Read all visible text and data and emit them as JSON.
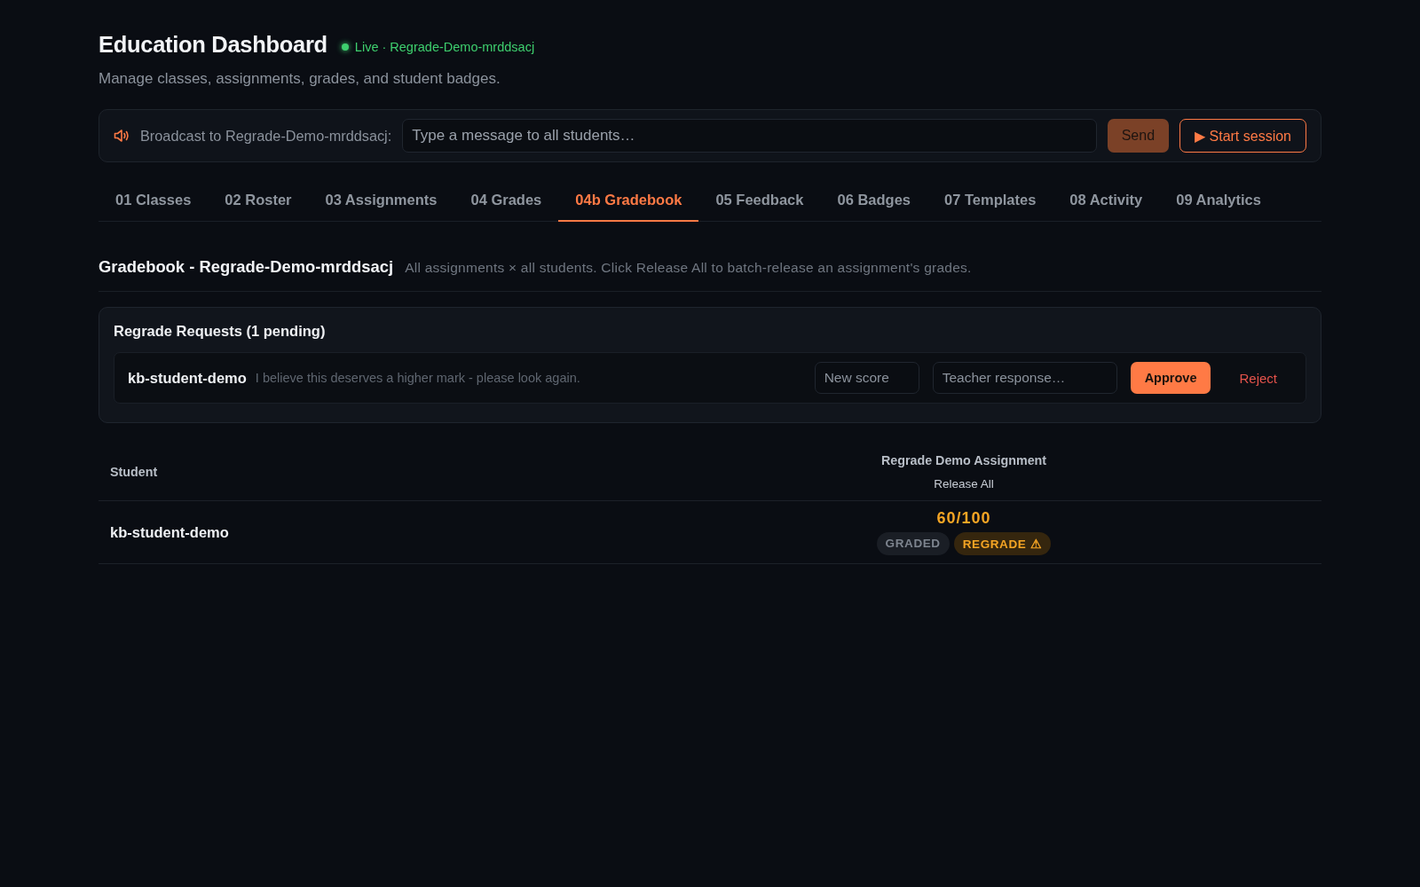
{
  "header": {
    "title": "Education Dashboard",
    "live_status": "Live · Regrade-Demo-mrddsacj",
    "subtitle": "Manage classes, assignments, grades, and student badges."
  },
  "broadcast": {
    "label": "Broadcast to Regrade-Demo-mrddsacj:",
    "placeholder": "Type a message to all students…",
    "send_button": {
      "label": "Send",
      "disabled": true
    },
    "start_button": {
      "label": "▶ Start session"
    }
  },
  "tabs": [
    {
      "label": "01 Classes",
      "selected": false
    },
    {
      "label": "02 Roster",
      "selected": false
    },
    {
      "label": "03 Assignments",
      "selected": false
    },
    {
      "label": "04 Grades",
      "selected": false
    },
    {
      "label": "04b Gradebook",
      "selected": true
    },
    {
      "label": "05 Feedback",
      "selected": false
    },
    {
      "label": "06 Badges",
      "selected": false
    },
    {
      "label": "07 Templates",
      "selected": false
    },
    {
      "label": "08 Activity",
      "selected": false
    },
    {
      "label": "09 Analytics",
      "selected": false
    }
  ],
  "gradebook": {
    "title": "Gradebook - Regrade-Demo-mrddsacj",
    "description": "All assignments × all students. Click Release All to batch-release an assignment's grades.",
    "regrade_requests": {
      "title": "Regrade Requests (1 pending)",
      "requests": [
        {
          "student": "kb-student-demo",
          "message": "I believe this deserves a higher mark - please look again.",
          "score_placeholder": "New score",
          "response_placeholder": "Teacher response…",
          "approve_button": "Approve",
          "reject_button": "Reject"
        }
      ]
    },
    "table": {
      "columns": [
        {
          "label": "Student"
        },
        {
          "label": "Regrade Demo Assignment",
          "action": "Release All"
        }
      ],
      "rows": [
        {
          "cells": [
            {
              "kind": "name",
              "text": "kb-student-demo"
            },
            {
              "kind": "grade",
              "score": "60/100",
              "badges": [
                {
                  "label": "GRADED",
                  "kind": "neutral"
                },
                {
                  "label": "REGRADE ⚠",
                  "kind": "warning"
                }
              ]
            }
          ]
        }
      ]
    }
  }
}
